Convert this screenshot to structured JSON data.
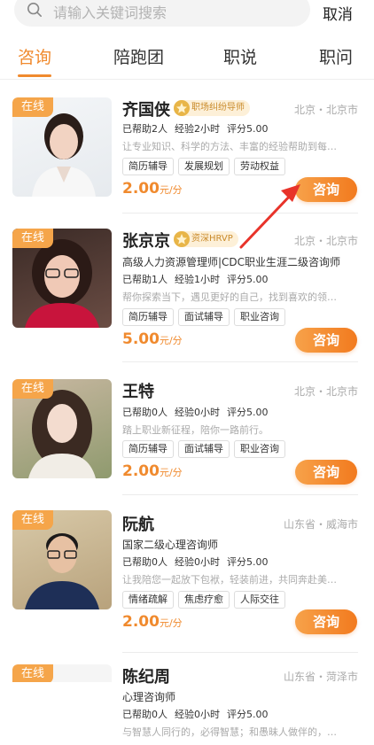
{
  "search": {
    "placeholder": "请输入关键词搜索",
    "cancel_label": "取消"
  },
  "tabs": [
    {
      "label": "咨询",
      "active": true
    },
    {
      "label": "陪跑团",
      "active": false
    },
    {
      "label": "职说",
      "active": false
    },
    {
      "label": "职问",
      "active": false
    }
  ],
  "colors": {
    "accent": "#f08a2e",
    "badge": "#f5a54a",
    "arrow": "#e8332a"
  },
  "consultants": [
    {
      "online": "在线",
      "name": "齐国侠",
      "badge": "职场纠纷导师",
      "location": "北京・北京市",
      "subtitle": "",
      "helped": "已帮助2人",
      "experience": "经验2小时",
      "rating": "评分5.00",
      "desc": "让专业知识、科学的方法、丰富的经验帮助到每…",
      "tags": [
        "简历辅导",
        "发展规划",
        "劳动权益"
      ],
      "price": "2.00",
      "unit": "元/分",
      "button": "咨询"
    },
    {
      "online": "在线",
      "name": "张京京",
      "badge": "资深HRVP",
      "location": "北京・北京市",
      "subtitle": "高级人力资源管理师|CDC职业生涯二级咨询师",
      "helped": "已帮助1人",
      "experience": "经验1小时",
      "rating": "评分5.00",
      "desc": "帮你探索当下，遇见更好的自己，找到喜欢的领…",
      "tags": [
        "简历辅导",
        "面试辅导",
        "职业咨询"
      ],
      "price": "5.00",
      "unit": "元/分",
      "button": "咨询"
    },
    {
      "online": "在线",
      "name": "王特",
      "badge": "",
      "location": "北京・北京市",
      "subtitle": "",
      "helped": "已帮助0人",
      "experience": "经验0小时",
      "rating": "评分5.00",
      "desc": "踏上职业新征程，陪你一路前行。",
      "tags": [
        "简历辅导",
        "面试辅导",
        "职业咨询"
      ],
      "price": "2.00",
      "unit": "元/分",
      "button": "咨询"
    },
    {
      "online": "在线",
      "name": "阮航",
      "badge": "",
      "location": "山东省・威海市",
      "subtitle": "国家二级心理咨询师",
      "helped": "已帮助0人",
      "experience": "经验0小时",
      "rating": "评分5.00",
      "desc": "让我陪您一起放下包袱，轻装前进，共同奔赴美…",
      "tags": [
        "情绪疏解",
        "焦虑疗愈",
        "人际交往"
      ],
      "price": "2.00",
      "unit": "元/分",
      "button": "咨询"
    },
    {
      "online": "在线",
      "name": "陈纪周",
      "badge": "",
      "location": "山东省・菏泽市",
      "subtitle": "心理咨询师",
      "helped": "已帮助0人",
      "experience": "经验0小时",
      "rating": "评分5.00",
      "desc": "与智慧人同行的，必得智慧；和愚昧人做伴的，…",
      "tags": [],
      "price": "",
      "unit": "",
      "button": ""
    }
  ]
}
